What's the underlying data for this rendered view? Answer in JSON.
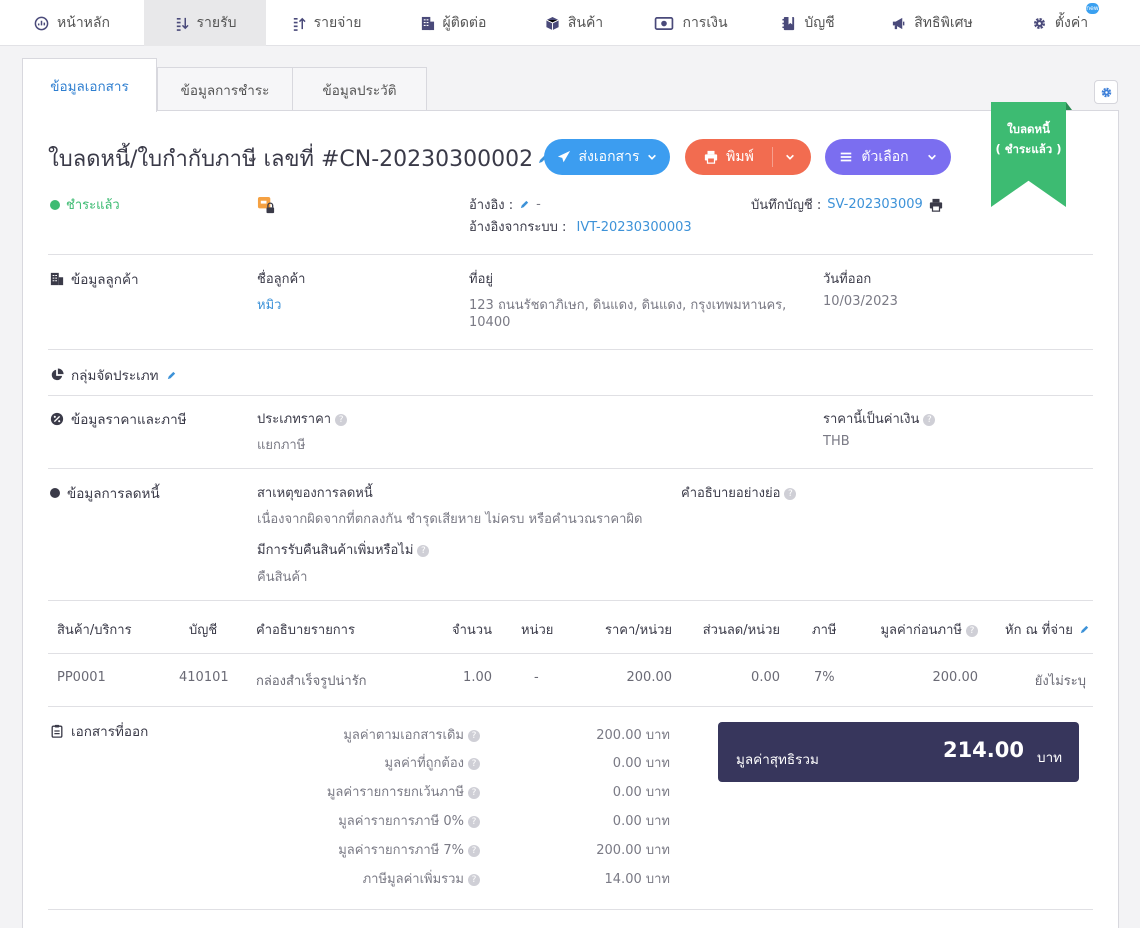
{
  "nav": {
    "items": [
      {
        "label": "หน้าหลัก",
        "icon": "dashboard-icon"
      },
      {
        "label": "รายรับ",
        "icon": "income-icon"
      },
      {
        "label": "รายจ่าย",
        "icon": "expense-icon"
      },
      {
        "label": "ผู้ติดต่อ",
        "icon": "contacts-icon"
      },
      {
        "label": "สินค้า",
        "icon": "product-box-icon"
      },
      {
        "label": "การเงิน",
        "icon": "money-icon"
      },
      {
        "label": "บัญชี",
        "icon": "account-book-icon"
      },
      {
        "label": "สิทธิพิเศษ",
        "icon": "megaphone-icon"
      },
      {
        "label": "ตั้งค่า",
        "icon": "settings-gear-icon"
      }
    ],
    "active_index": 1,
    "settings_badge": "new"
  },
  "tabs": [
    "ข้อมูลเอกสาร",
    "ข้อมูลการชำระ",
    "ข้อมูลประวัติ"
  ],
  "doc": {
    "title": "ใบลดหนี้/ใบกำกับภาษี เลขที่ #CN-20230300002",
    "ribbon_line1": "ใบลดหนี้",
    "ribbon_line2": "( ชำระแล้ว )",
    "buttons": {
      "send": "ส่งเอกสาร",
      "print": "พิมพ์",
      "options": "ตัวเลือก"
    },
    "status": "ชำระแล้ว",
    "ref_label": "อ้างอิง :",
    "ref_value": "-",
    "sys_ref_label": "อ้างอิงจากระบบ :",
    "sys_ref_value": "IVT-20230300003",
    "journal_label": "บันทึกบัญชี :",
    "journal_value": "SV-202303009"
  },
  "customer": {
    "section": "ข้อมูลลูกค้า",
    "name_label": "ชื่อลูกค้า",
    "name": "หมิว",
    "address_label": "ที่อยู่",
    "address_line1": "123 ถนนรัชดาภิเษก, ดินแดง, ดินแดง, กรุงเทพมหานคร,",
    "address_line2": "10400",
    "date_label": "วันที่ออก",
    "date": "10/03/2023"
  },
  "group": {
    "section": "กลุ่มจัดประเภท"
  },
  "pricing": {
    "section": "ข้อมูลราคาและภาษี",
    "type_label": "ประเภทราคา",
    "type_value": "แยกภาษี",
    "currency_label": "ราคานี้เป็นค่าเงิน",
    "currency_value": "THB"
  },
  "credit": {
    "section": "ข้อมูลการลดหนี้",
    "reason_label": "สาเหตุของการลดหนี้",
    "reason_value": "เนื่องจากผิดจากที่ตกลงกัน ชำรุดเสียหาย ไม่ครบ หรือคำนวณราคาผิด",
    "desc_label": "คำอธิบายอย่างย่อ",
    "return_label": "มีการรับคืนสินค้าเพิ่มหรือไม่",
    "return_value": "คืนสินค้า"
  },
  "table": {
    "headers": {
      "product": "สินค้า/บริการ",
      "account": "บัญชี",
      "desc": "คำอธิบายรายการ",
      "qty": "จำนวน",
      "unit": "หน่วย",
      "price": "ราคา/หน่วย",
      "discount": "ส่วนลด/หน่วย",
      "vat": "ภาษี",
      "pretax": "มูลค่าก่อนภาษี",
      "wht": "หัก ณ ที่จ่าย"
    },
    "rows": [
      {
        "product": "PP0001",
        "account": "410101",
        "desc": "กล่องสำเร็จรูปน่ารัก",
        "qty": "1.00",
        "unit": "-",
        "price": "200.00",
        "discount": "0.00",
        "vat": "7%",
        "pretax": "200.00",
        "wht": "ยังไม่ระบุ"
      }
    ]
  },
  "summary": {
    "section": "เอกสารที่ออก",
    "rows": [
      {
        "label": "มูลค่าตามเอกสารเดิม",
        "value": "200.00 บาท"
      },
      {
        "label": "มูลค่าที่ถูกต้อง",
        "value": "0.00 บาท"
      },
      {
        "label": "มูลค่ารายการยกเว้นภาษี",
        "value": "0.00 บาท"
      },
      {
        "label": "มูลค่ารายการภาษี 0%",
        "value": "0.00 บาท"
      },
      {
        "label": "มูลค่ารายการภาษี 7%",
        "value": "200.00 บาท"
      },
      {
        "label": "ภาษีมูลค่าเพิ่มรวม",
        "value": "14.00 บาท"
      }
    ],
    "net_label": "มูลค่าสุทธิรวม",
    "net_value": "214.00",
    "net_unit": "บาท"
  },
  "colors": {
    "send": "#3c9df0",
    "print": "#f26c50",
    "options": "#7b6ef0",
    "ribbon": "#3dbb72",
    "total_bg": "#37365c",
    "link": "#3d92d8"
  }
}
